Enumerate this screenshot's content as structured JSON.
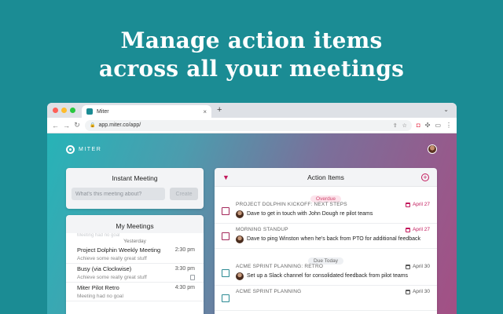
{
  "headline": {
    "line1": "Manage action items",
    "line2": "across all your meetings"
  },
  "browser": {
    "tab_title": "Miter",
    "tab_close": "×",
    "new_tab": "+",
    "url": "app.miter.co/app/",
    "icons": [
      "traffic-light-close",
      "traffic-light-minimize",
      "traffic-light-maximize",
      "back-arrow",
      "forward-arrow",
      "reload",
      "lock",
      "share",
      "bookmark-star",
      "pocket",
      "extensions-puzzle",
      "sidebar",
      "more-vertical"
    ],
    "colors": {
      "close": "#ff5f57",
      "minimize": "#febc2e",
      "maximize": "#28c840"
    }
  },
  "app": {
    "logo_text": "MITER",
    "instant_meeting": {
      "title": "Instant Meeting",
      "placeholder": "What's this meeting about?",
      "create_label": "Create"
    },
    "my_meetings": {
      "title": "My Meetings",
      "faded_top": "Meeting had no goal",
      "day_label": "Yesterday",
      "items": [
        {
          "title": "Project Dolphin Weekly Meeting",
          "time": "2:30 pm",
          "goal": "Achieve some really great stuff"
        },
        {
          "title": "Busy (via Clockwise)",
          "time": "3:30 pm",
          "goal": "Achieve some really great stuff"
        },
        {
          "title": "Miter Pilot Retro",
          "time": "4:30 pm",
          "goal": "Meeting had no goal"
        }
      ]
    },
    "action_items": {
      "title": "Action Items",
      "overdue_label": "Overdue",
      "due_today_label": "Due Today",
      "items": [
        {
          "meeting": "PROJECT DOLPHIN KICKOFF: NEXT STEPS",
          "date": "April 27",
          "text": "Dave to get in touch with John Dough re pilot teams"
        },
        {
          "meeting": "MORNING STANDUP",
          "date": "April 27",
          "text": "Dave to ping Winston when he's back from PTO for additional feedback"
        },
        {
          "meeting": "ACME SPRINT PLANNING: RETRO",
          "date": "April 30",
          "text": "Set up a Slack channel for consolidated feedback from pilot teams"
        },
        {
          "meeting": "ACME SPRINT PLANNING",
          "date": "April 30",
          "text": ""
        }
      ]
    }
  }
}
